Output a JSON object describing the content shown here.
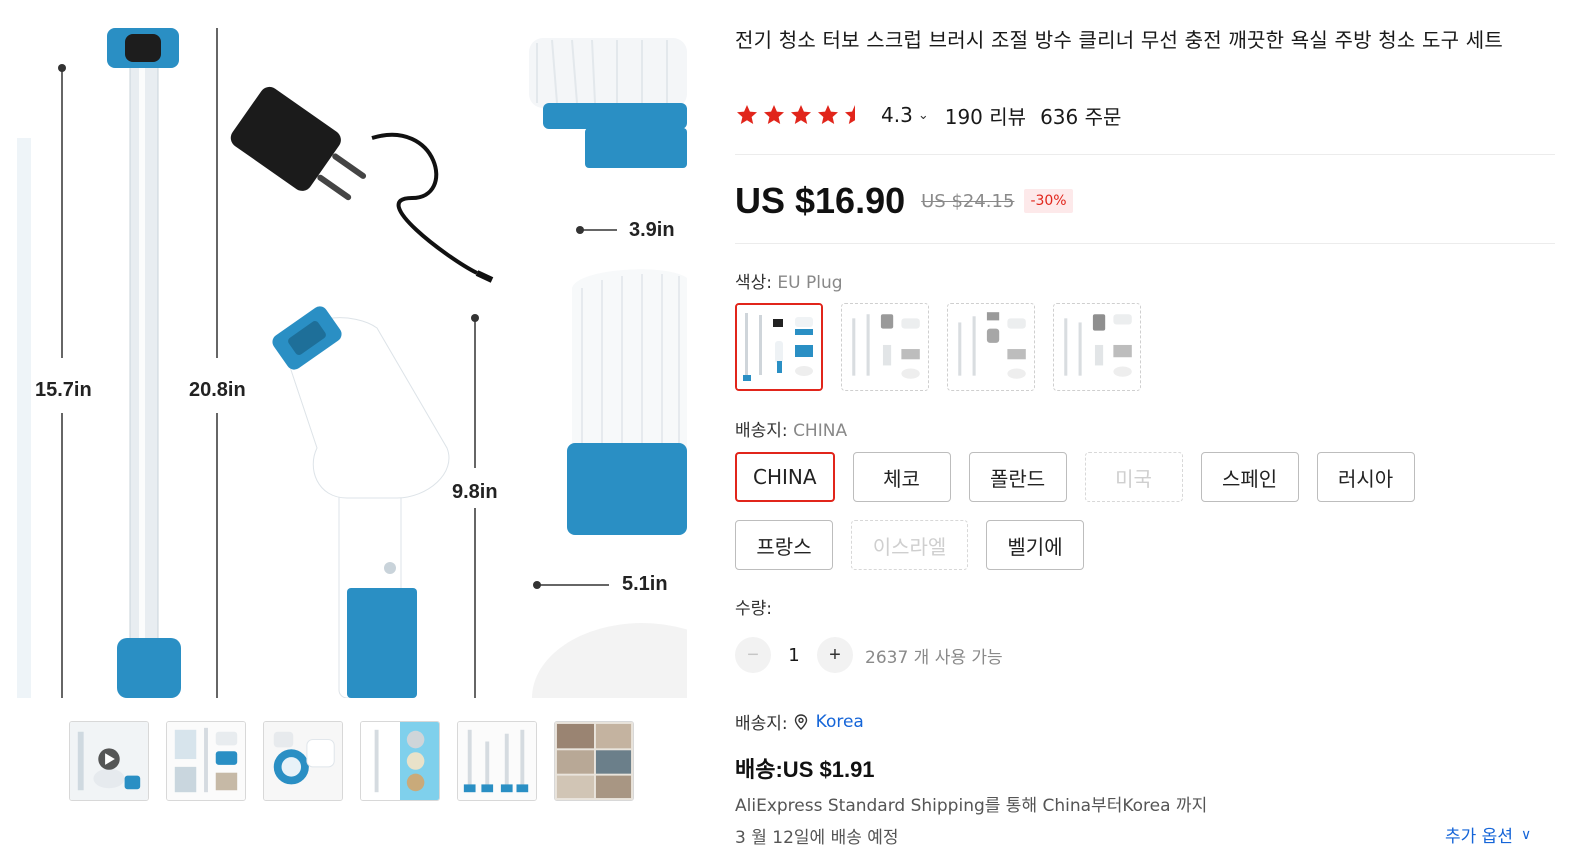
{
  "product": {
    "title": "전기 청소 터보 스크럽 브러시 조절 방수 클리너 무선 충전 깨끗한 욕실 주방 청소 도구 세트",
    "rating": "4.3",
    "rating_chevron": "⌄",
    "reviews": "190 리뷰",
    "orders": "636 주문",
    "stars": [
      1,
      1,
      1,
      1,
      0.5
    ]
  },
  "gallery": {
    "dimensions": [
      "15.7in",
      "20.8in",
      "9.8in",
      "3.9in",
      "5.1in"
    ],
    "thumbnails": [
      "video-thumb",
      "thumb-2",
      "thumb-3",
      "thumb-4",
      "thumb-5",
      "thumb-6"
    ]
  },
  "price": {
    "current": "US $16.90",
    "original": "US $24.15",
    "discount": "-30%"
  },
  "color": {
    "label": "색상:",
    "selected": "EU Plug",
    "options": 4
  },
  "ship_from": {
    "label": "배송지:",
    "selected": "CHINA",
    "options": [
      {
        "label": "CHINA",
        "state": "selected"
      },
      {
        "label": "체코",
        "state": "normal"
      },
      {
        "label": "폴란드",
        "state": "normal"
      },
      {
        "label": "미국",
        "state": "disabled"
      },
      {
        "label": "스페인",
        "state": "normal"
      },
      {
        "label": "러시아",
        "state": "normal"
      },
      {
        "label": "프랑스",
        "state": "normal"
      },
      {
        "label": "이스라엘",
        "state": "disabled"
      },
      {
        "label": "벨기에",
        "state": "normal"
      }
    ]
  },
  "quantity": {
    "label": "수량:",
    "minus": "−",
    "value": "1",
    "plus": "+",
    "available": "2637 개 사용 가능"
  },
  "delivery": {
    "ship_to_label": "배송지:",
    "country": "Korea",
    "cost": "배송:US $1.91",
    "method": "AliExpress Standard Shipping를 통해 China부터Korea 까지",
    "eta": "3 월 12일에 배송 예정",
    "more_options": "추가 옵션",
    "more_chevron": "∨"
  },
  "colors": {
    "accent_red": "#e1251b",
    "link_blue": "#1565d8",
    "product_blue": "#2a8fc4",
    "star_red": "#e1251b"
  }
}
